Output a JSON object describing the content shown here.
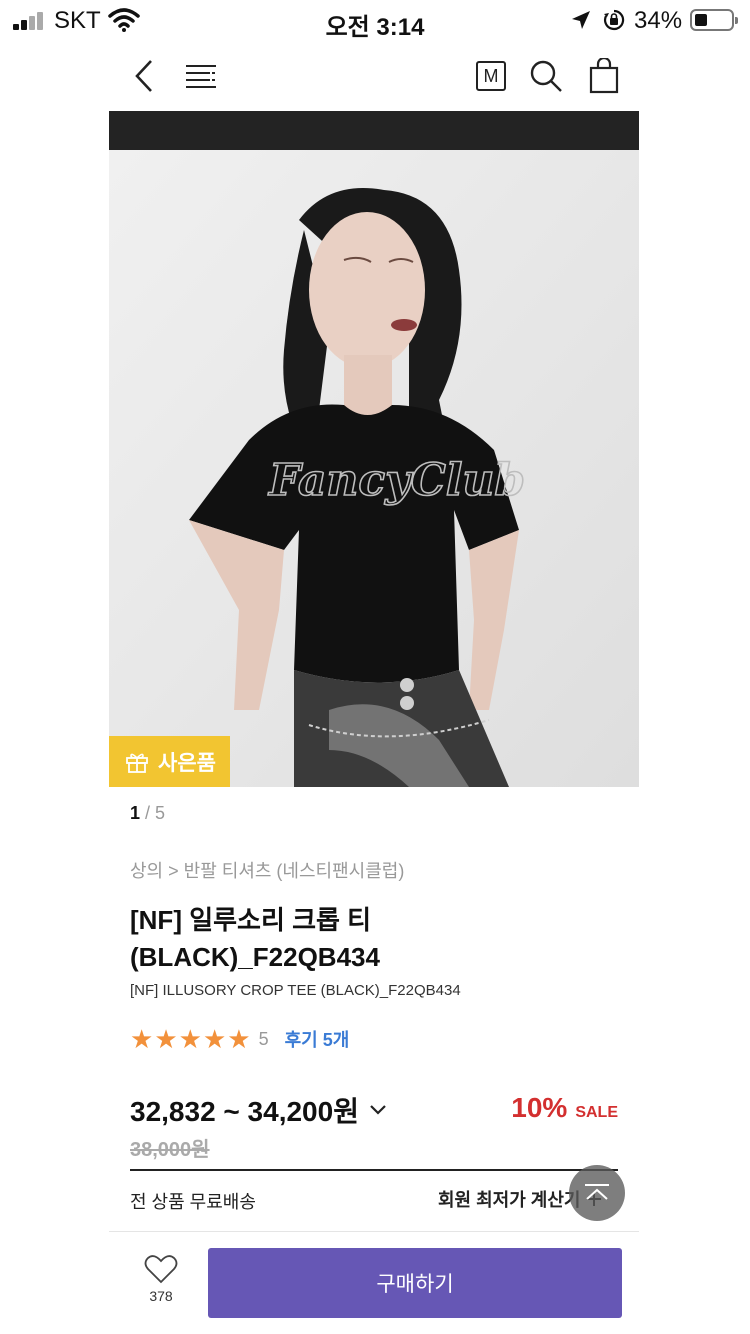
{
  "status_bar": {
    "carrier": "SKT",
    "time": "오전 3:14",
    "battery_percent": "34%",
    "battery_level": 0.34
  },
  "nav": {
    "icons": [
      "back-icon",
      "menu-icon",
      "membership-m-icon",
      "search-icon",
      "shopping-bag-icon"
    ],
    "m_label": "M"
  },
  "product_image": {
    "gift_badge": "사은품",
    "pager_current": "1",
    "pager_separator": " / ",
    "pager_total": "5",
    "print_text": "FancyClub"
  },
  "product": {
    "breadcrumb": "상의 > 반팔 티셔츠 (네스티팬시클럽)",
    "title_line1": "[NF] 일루소리 크롭 티",
    "title_line2": "(BLACK)_F22QB434",
    "subtitle": "[NF] ILLUSORY CROP TEE (BLACK)_F22QB434",
    "rating_stars": 5,
    "rating_value": "5",
    "review_link": "후기 5개",
    "price_range": "32,832 ~ 34,200원",
    "original_price": "38,000원",
    "discount_percent": "10%",
    "sale_label": "SALE",
    "shipping": "전 상품 무료배송",
    "member_calc": "회원 최저가 계산기"
  },
  "bottom_bar": {
    "wish_count": "378",
    "buy_label": "구매하기"
  },
  "colors": {
    "accent_purple": "#6657b5",
    "star_orange": "#f2913b",
    "discount_red": "#d32f2f",
    "gift_yellow": "#f2c531",
    "review_blue": "#3a7bd5"
  }
}
